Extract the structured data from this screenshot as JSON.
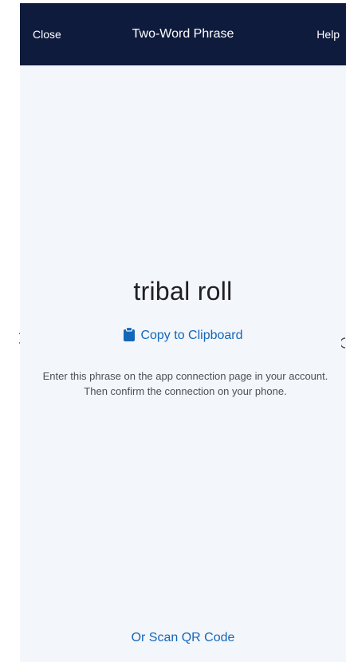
{
  "nav": {
    "close_label": "Close",
    "title": "Two-Word Phrase",
    "help_label": "Help"
  },
  "main": {
    "phrase": "tribal roll",
    "copy_label": "Copy to Clipboard",
    "copy_icon": "clipboard-icon",
    "description": "Enter this phrase on the app connection page in your account. Then confirm the connection on your phone.",
    "scan_label": "Or Scan QR Code"
  },
  "colors": {
    "nav_background": "#0f1b3d",
    "page_background": "#f3f6fb",
    "link_blue": "#1467b8",
    "phrase_text": "#1f1f24",
    "body_text": "#4b4f57"
  }
}
